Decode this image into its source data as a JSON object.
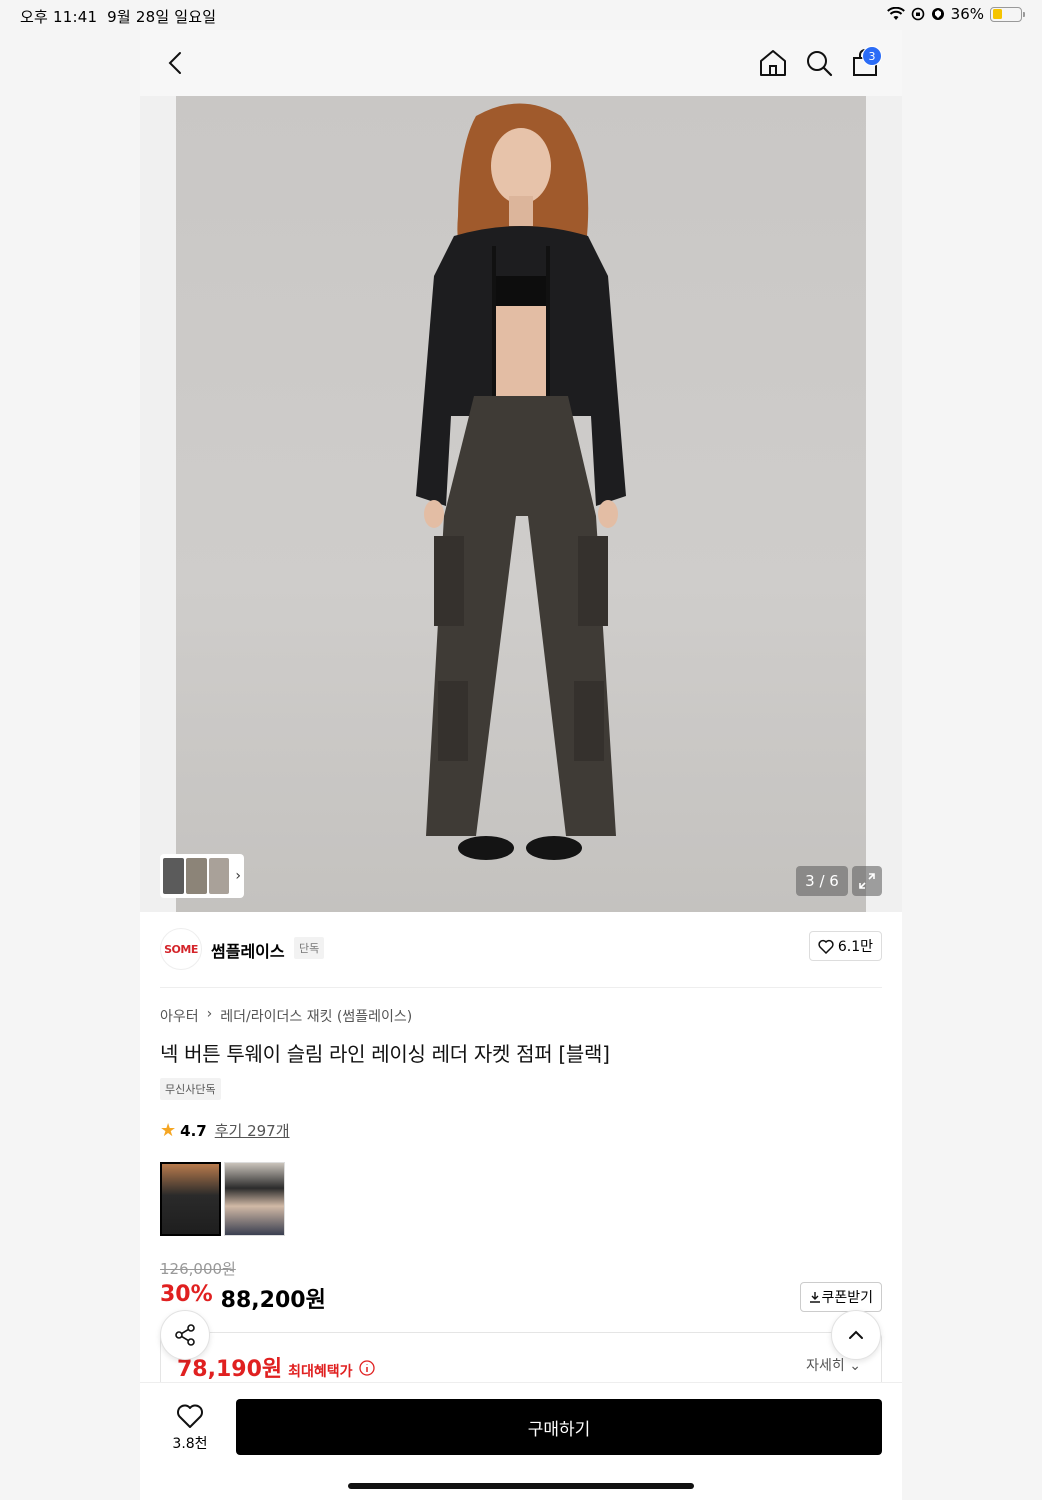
{
  "status": {
    "time": "오후 11:41",
    "date": "9월 28일 일요일",
    "battery": "36%",
    "battery_level": 0.36
  },
  "nav": {
    "cart_count": "3"
  },
  "gallery": {
    "counter": "3 / 6"
  },
  "brand": {
    "logo": "SOME",
    "name": "썸플레이스",
    "tag": "단독",
    "likes": "6.1만"
  },
  "breadcrumb": {
    "category": "아우터",
    "subcategory": "레더/라이더스 재킷 (썸플레이스)"
  },
  "product": {
    "title": "넥 버튼 투웨이 슬림 라인 레이싱 레더 자켓 점퍼 [블랙]",
    "exclusive": "무신사단독",
    "rating": "4.7",
    "reviews": "후기 297개"
  },
  "price": {
    "original": "126,000원",
    "discount": "30%",
    "sale": "88,200원",
    "coupon": "쿠폰받기",
    "best": "78,190원",
    "best_label": "최대혜택가",
    "detail": "자세히"
  },
  "bottom": {
    "wish_count": "3.8천",
    "buy": "구매하기"
  },
  "colors": {
    "accent": "#e02020",
    "badge": "#2b6cf6"
  }
}
